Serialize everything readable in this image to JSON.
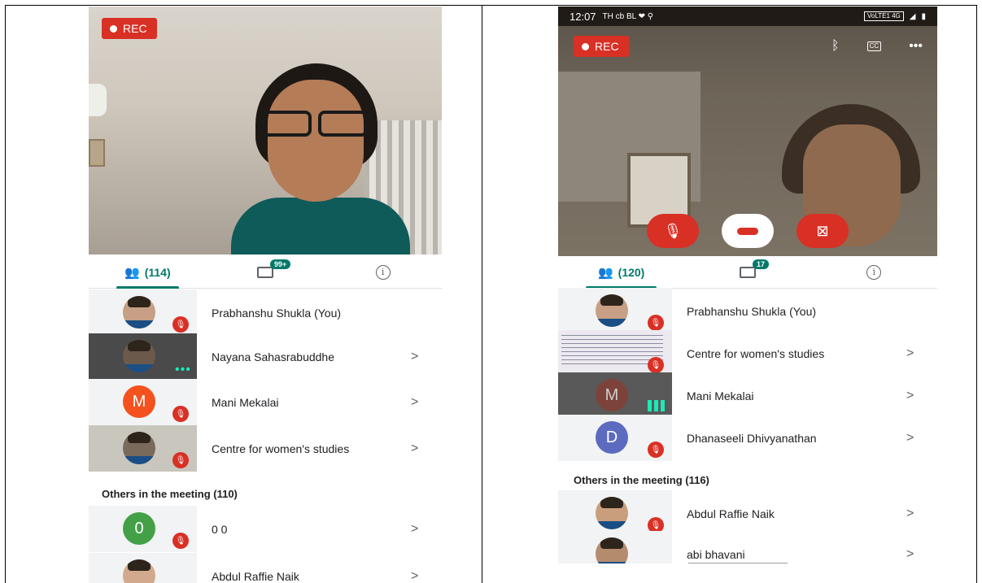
{
  "left": {
    "rec": "REC",
    "people_count": "(114)",
    "chat_badge": "99+",
    "participants": [
      {
        "name": "Prabhanshu Shukla (You)",
        "chevron": ""
      },
      {
        "name": "Nayana Sahasrabuddhe",
        "chevron": ">"
      },
      {
        "name": "Mani Mekalai",
        "chevron": ">",
        "initial": "M",
        "color": "#f4511e"
      },
      {
        "name": "Centre for women's studies",
        "chevron": ">"
      }
    ],
    "others_header": "Others in the meeting (110)",
    "others": [
      {
        "name": "0 0",
        "chevron": ">",
        "initial": "0",
        "color": "#43a047"
      },
      {
        "name": "Abdul Raffie Naik",
        "chevron": ">"
      }
    ]
  },
  "right": {
    "status": {
      "time": "12:07",
      "left_icons": "TH cb BL ❤ ⚲",
      "right_icons": "VoLTE1 4G"
    },
    "rec": "REC",
    "people_count": "(120)",
    "chat_badge": "17",
    "participants": [
      {
        "name": "Prabhanshu Shukla (You)",
        "chevron": ""
      },
      {
        "name": "Centre for women's studies",
        "chevron": ">"
      },
      {
        "name": "Mani Mekalai",
        "chevron": ">",
        "initial": "M",
        "color": "#8d3b2e"
      },
      {
        "name": "Dhanaseeli Dhivyanathan",
        "chevron": ">",
        "initial": "D",
        "color": "#5c6bc0"
      }
    ],
    "others_header": "Others in the meeting (116)",
    "others": [
      {
        "name": "Abdul Raffie Naik",
        "chevron": ">"
      },
      {
        "name": "abi bhavani",
        "chevron": ">"
      }
    ]
  },
  "icons": {
    "people": "people-icon",
    "chat": "chat-icon",
    "info": "info-icon",
    "mute": "mic-off-icon",
    "bluetooth": "bluetooth-icon",
    "captions": "captions-icon",
    "more": "more-icon",
    "hangup": "hangup-icon",
    "camera_off": "camera-off-icon"
  },
  "colors": {
    "accent": "#00796b",
    "rec": "#d93025",
    "mute": "#d93025"
  }
}
